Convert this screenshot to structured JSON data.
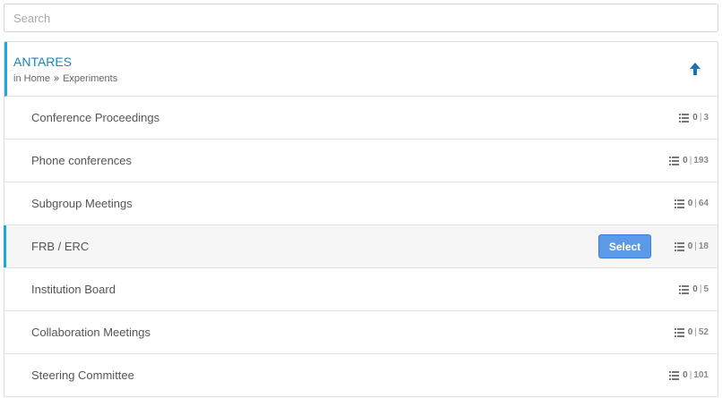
{
  "search": {
    "placeholder": "Search"
  },
  "header": {
    "title": "ANTARES",
    "breadcrumb_prefix": "in",
    "breadcrumb": [
      "Home",
      "Experiments"
    ],
    "breadcrumb_separator": "»"
  },
  "categories": [
    {
      "label": "Conference Proceedings",
      "selected_count": "0",
      "total": "3"
    },
    {
      "label": "Phone conferences",
      "selected_count": "0",
      "total": "193"
    },
    {
      "label": "Subgroup Meetings",
      "selected_count": "0",
      "total": "64"
    },
    {
      "label": "FRB / ERC",
      "selected_count": "0",
      "total": "18",
      "highlighted": true,
      "button_label": "Select"
    },
    {
      "label": "Institution Board",
      "selected_count": "0",
      "total": "5"
    },
    {
      "label": "Collaboration Meetings",
      "selected_count": "0",
      "total": "52"
    },
    {
      "label": "Steering Committee",
      "selected_count": "0",
      "total": "101"
    }
  ],
  "icons": {
    "header_action": "arrow-up-icon",
    "count": "list-icon"
  },
  "colors": {
    "accent": "#1ea7da",
    "title": "#1a87b5",
    "button": "#5b9ae6"
  }
}
